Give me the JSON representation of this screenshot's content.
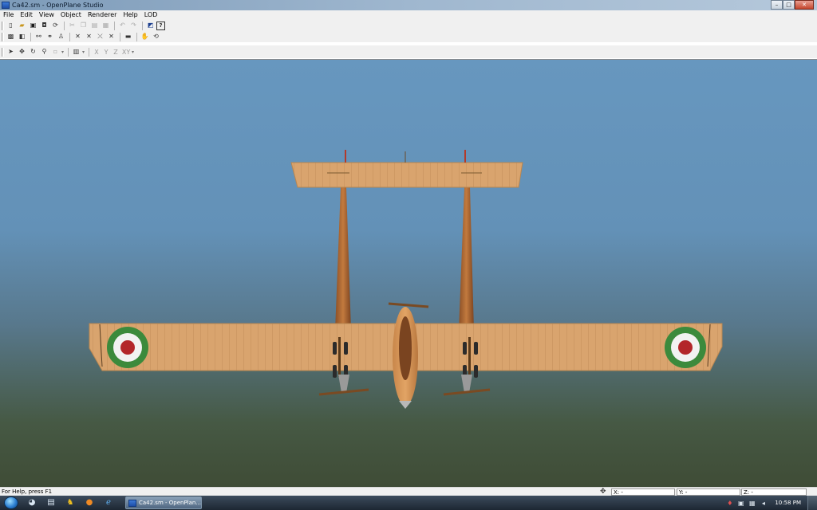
{
  "window": {
    "title": "Ca42.sm - OpenPlane Studio"
  },
  "menu": [
    "File",
    "Edit",
    "View",
    "Object",
    "Renderer",
    "Help",
    "LOD"
  ],
  "toolbar3": {
    "axes": [
      "X",
      "Y",
      "Z",
      "XY"
    ]
  },
  "status": {
    "help_text": "For Help, press F1",
    "x_label": "X: -",
    "y_label": "Y: -",
    "z_label": "Z: -"
  },
  "taskbar": {
    "item_label": "Ca42.sm - OpenPlan...",
    "clock": "10:58 PM"
  },
  "colors": {
    "sky": "#6797bf",
    "ground": "#3f4c36",
    "wood": "#d9a46e",
    "roundel_green": "#3c8a3c",
    "roundel_red": "#b3262a"
  }
}
